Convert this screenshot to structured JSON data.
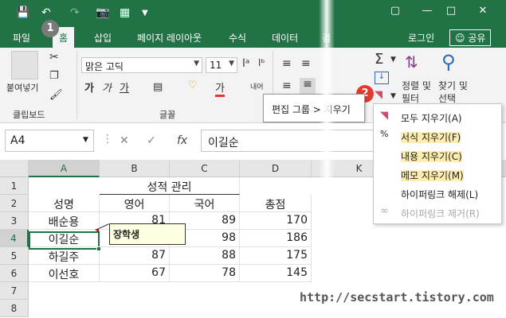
{
  "app": {
    "accent": "#217346"
  },
  "tabs": [
    {
      "label": "파일"
    },
    {
      "label": "홈"
    },
    {
      "label": "삽입"
    },
    {
      "label": "페이지 레이아웃"
    },
    {
      "label": "수식"
    },
    {
      "label": "데이터"
    },
    {
      "label": "검"
    }
  ],
  "account": {
    "login": "로그인",
    "share": "공유"
  },
  "steps": {
    "one": "1",
    "two": "2"
  },
  "ribbon": {
    "paste_label": "붙여넣기",
    "clipboard_group": "클립보드",
    "font_group": "글꼴",
    "font_name": "맑은 고딕",
    "font_size": "11",
    "wrap_label": "내어",
    "sort_filter_label": "정렬 및 필터",
    "find_select_label": "찾기 및 선택"
  },
  "tooltip": {
    "text": "편집 그룹 > 지우기"
  },
  "formula_bar": {
    "name_box": "A4",
    "fx": "fx",
    "value": "이길순"
  },
  "grid": {
    "columns": [
      "A",
      "B",
      "C",
      "D",
      "K"
    ],
    "rows": [
      "1",
      "2",
      "3",
      "4",
      "5",
      "6",
      "7",
      "8"
    ],
    "title": "성적 관리",
    "headers": [
      "성명",
      "영어",
      "국어",
      "총점"
    ],
    "data": [
      [
        "배순용",
        "81",
        "89",
        "170"
      ],
      [
        "이길순",
        "",
        "98",
        "186"
      ],
      [
        "하길주",
        "87",
        "88",
        "175"
      ],
      [
        "이선호",
        "67",
        "78",
        "145"
      ]
    ],
    "comment": "장학생"
  },
  "clear_menu": {
    "items": [
      {
        "label": "모두 지우기(A)",
        "icon": "eraser-icon"
      },
      {
        "label": "서식 지우기(F)",
        "icon": "clear-format-icon"
      },
      {
        "label": "내용 지우기(C)",
        "icon": ""
      },
      {
        "label": "메모 지우기(M)",
        "icon": ""
      },
      {
        "label": "하이퍼링크 해제(L)",
        "icon": ""
      },
      {
        "label": "하이퍼링크 제거(R)",
        "icon": "unlink-icon"
      }
    ]
  },
  "watermark": "http://secstart.tistory.com"
}
